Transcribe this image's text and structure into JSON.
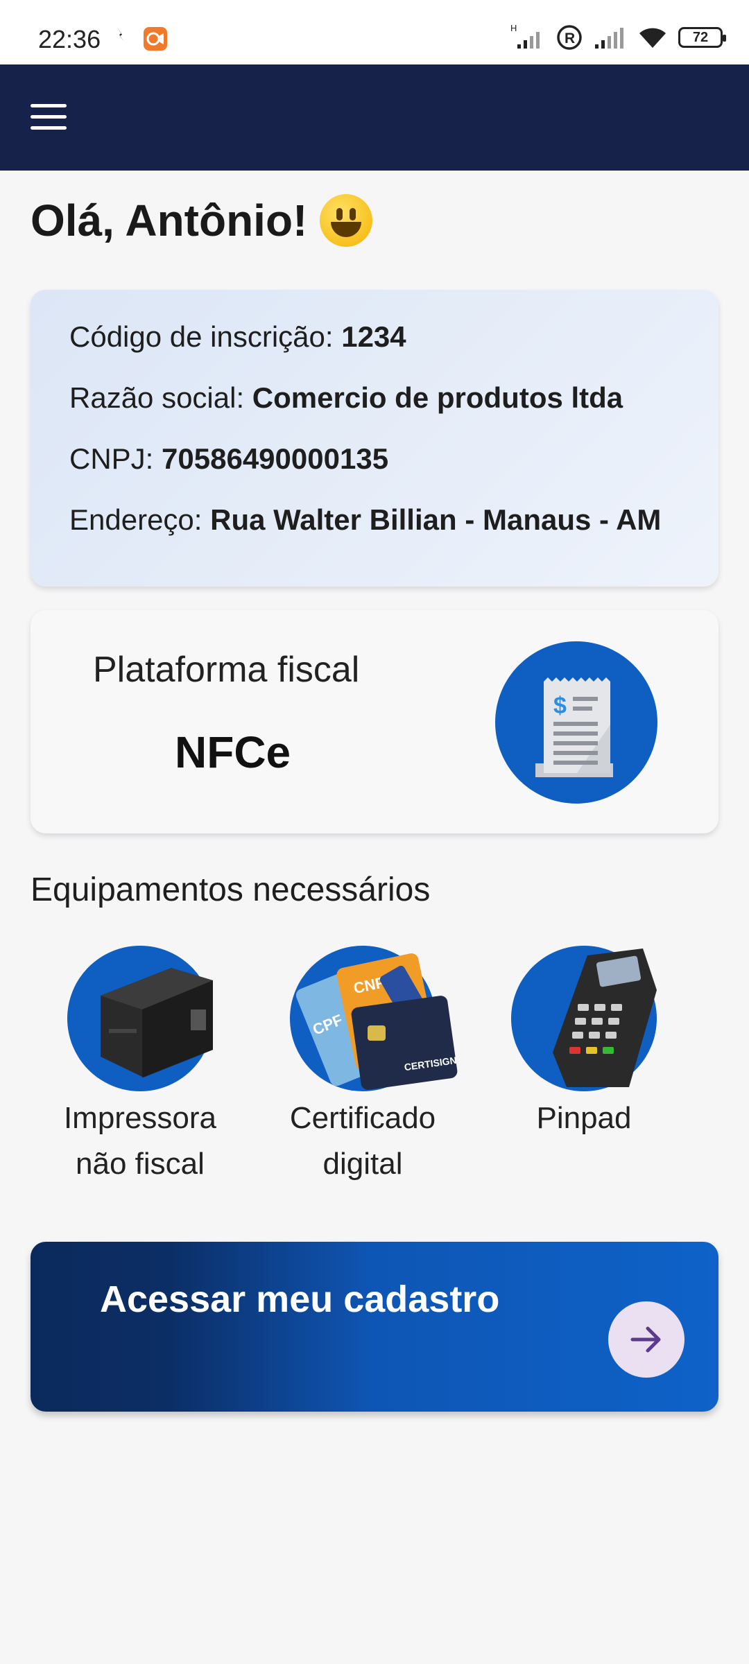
{
  "status_bar": {
    "time": "22:36",
    "network_label": "H",
    "battery": "72"
  },
  "greeting": {
    "text": "Olá, Antônio!"
  },
  "info_card": {
    "registration_label": "Código de inscrição:",
    "registration_value": "1234",
    "company_label": "Razão social:",
    "company_value": "Comercio de produtos ltda",
    "cnpj_label": "CNPJ:",
    "cnpj_value": "70586490000135",
    "address_label": "Endereço:",
    "address_value": "Rua Walter Billian - Manaus - AM"
  },
  "platform": {
    "label": "Plataforma fiscal",
    "value": "NFCe",
    "icon": "receipt-icon"
  },
  "equipment": {
    "title": "Equipamentos necessários",
    "items": [
      {
        "line1": "Impressora",
        "line2": "não fiscal",
        "icon": "printer-icon"
      },
      {
        "line1": "Certificado",
        "line2": "digital",
        "icon": "certificate-cards-icon",
        "card_labels": [
          "CPF",
          "CNPJ",
          "CERTISIGN"
        ]
      },
      {
        "line1": "Pinpad",
        "line2": "",
        "icon": "pinpad-icon"
      }
    ]
  },
  "cta": {
    "label": "Acessar meu cadastro",
    "icon": "arrow-right-icon"
  },
  "colors": {
    "app_bar": "#17224a",
    "accent_blue": "#0f5ec2",
    "arrow_color": "#5b3a8e"
  }
}
